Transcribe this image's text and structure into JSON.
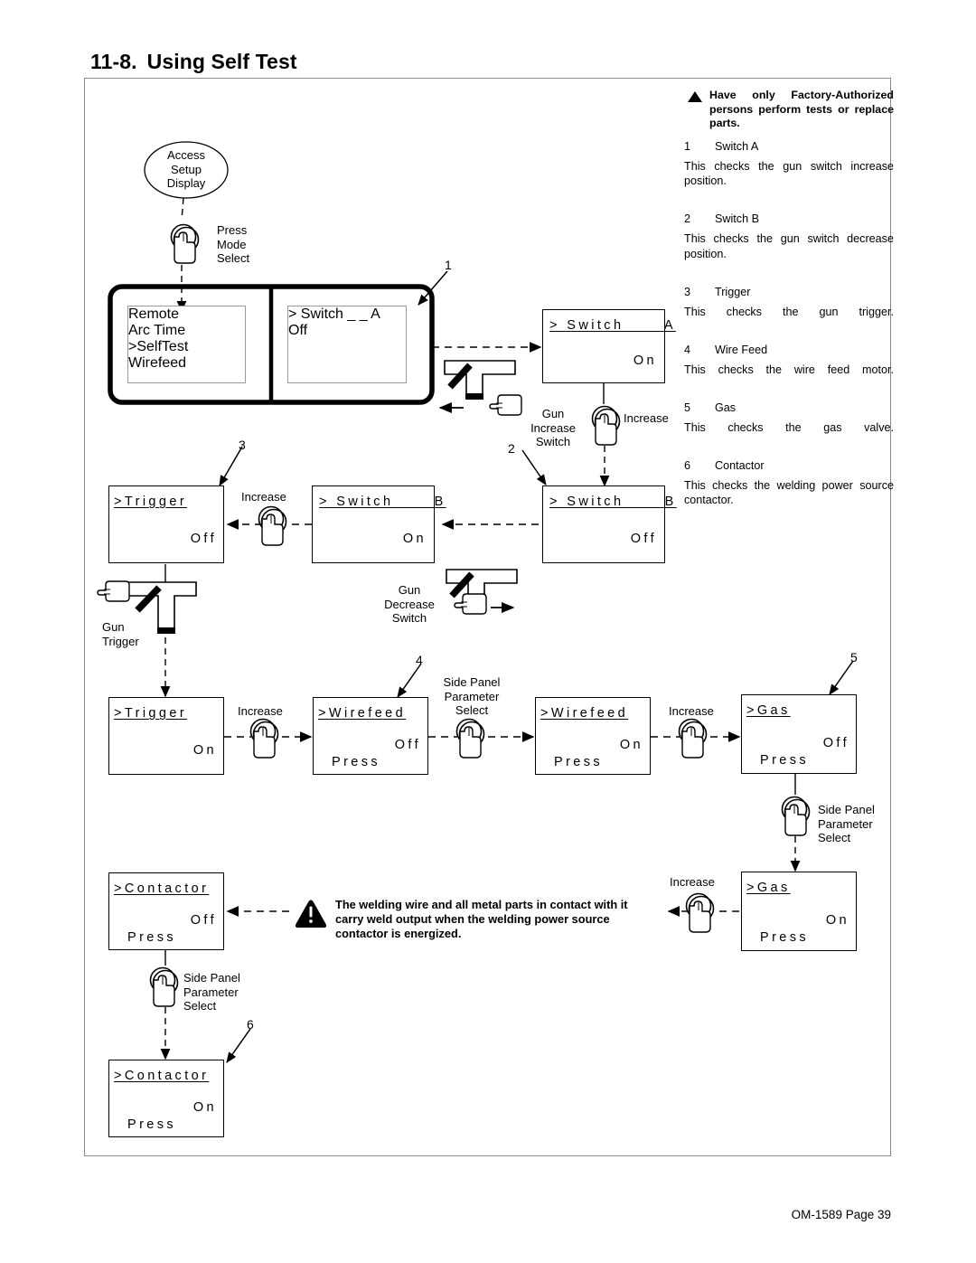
{
  "page": {
    "section_number": "11-8.",
    "title": "Using Self Test",
    "footer": "OM-1589 Page 39"
  },
  "instructions": {
    "warning_icon": "warning-triangle-icon",
    "warning_text": "Have only Factory-Authorized persons perform tests or replace parts.",
    "items": [
      {
        "n": "1",
        "name": "Switch A",
        "desc": "This checks the gun switch increase position."
      },
      {
        "n": "2",
        "name": "Switch B",
        "desc": "This checks the gun switch decrease position."
      },
      {
        "n": "3",
        "name": "Trigger",
        "desc": "This checks the gun trigger."
      },
      {
        "n": "4",
        "name": "Wire Feed",
        "desc": "This checks the wire feed motor."
      },
      {
        "n": "5",
        "name": "Gas",
        "desc": "This checks the gas valve."
      },
      {
        "n": "6",
        "name": "Contactor",
        "desc": "This checks the welding power source contactor."
      }
    ]
  },
  "diagram": {
    "start_node": {
      "l1": "Access",
      "l2": "Setup",
      "l3": "Display"
    },
    "actions": {
      "press_mode_select": {
        "l1": "Press",
        "l2": "Mode",
        "l3": "Select"
      },
      "increase": "Increase",
      "gun_increase_switch": {
        "l1": "Gun",
        "l2": "Increase",
        "l3": "Switch"
      },
      "gun_decrease_switch": {
        "l1": "Gun",
        "l2": "Decrease",
        "l3": "Switch"
      },
      "gun_trigger": {
        "l1": "Gun",
        "l2": "Trigger"
      },
      "side_panel_parameter_select": {
        "l1": "Side Panel",
        "l2": "Parameter",
        "l3": "Select"
      }
    },
    "callouts": [
      "1",
      "2",
      "3",
      "4",
      "5",
      "6"
    ],
    "screens": {
      "menu": {
        "lines": [
          "Remote",
          "Arc Time",
          ">SelfTest",
          "Wirefeed"
        ],
        "selected_index": 2
      },
      "switch_a_off": {
        "title": "> Switch _ _ A",
        "value": "Off"
      },
      "switch_a_on": {
        "title": "> Switch _ _ A",
        "value": "On"
      },
      "switch_b_off": {
        "title": "> Switch _ _ B",
        "value": "Off"
      },
      "switch_b_on": {
        "title": "> Switch _ _ B",
        "value": "On"
      },
      "trigger_off": {
        "title": ">Trigger",
        "value": "Off"
      },
      "trigger_on": {
        "title": ">Trigger",
        "value": "On"
      },
      "wirefeed_off": {
        "title": ">Wirefeed",
        "value": "Off",
        "hint": "Press"
      },
      "wirefeed_on": {
        "title": ">Wirefeed",
        "value": "On",
        "hint": "Press"
      },
      "gas_off": {
        "title": ">Gas",
        "value": "Off",
        "hint": "Press"
      },
      "gas_on": {
        "title": ">Gas",
        "value": "On",
        "hint": "Press"
      },
      "contactor_off": {
        "title": ">Contactor",
        "value": "Off",
        "hint": "Press"
      },
      "contactor_on": {
        "title": ">Contactor",
        "value": "On",
        "hint": "Press"
      }
    },
    "inline_warning": {
      "icon": "warning-exclamation-icon",
      "text": "The welding wire and all metal parts in contact with it carry weld output when the welding power source contactor is energized."
    }
  }
}
